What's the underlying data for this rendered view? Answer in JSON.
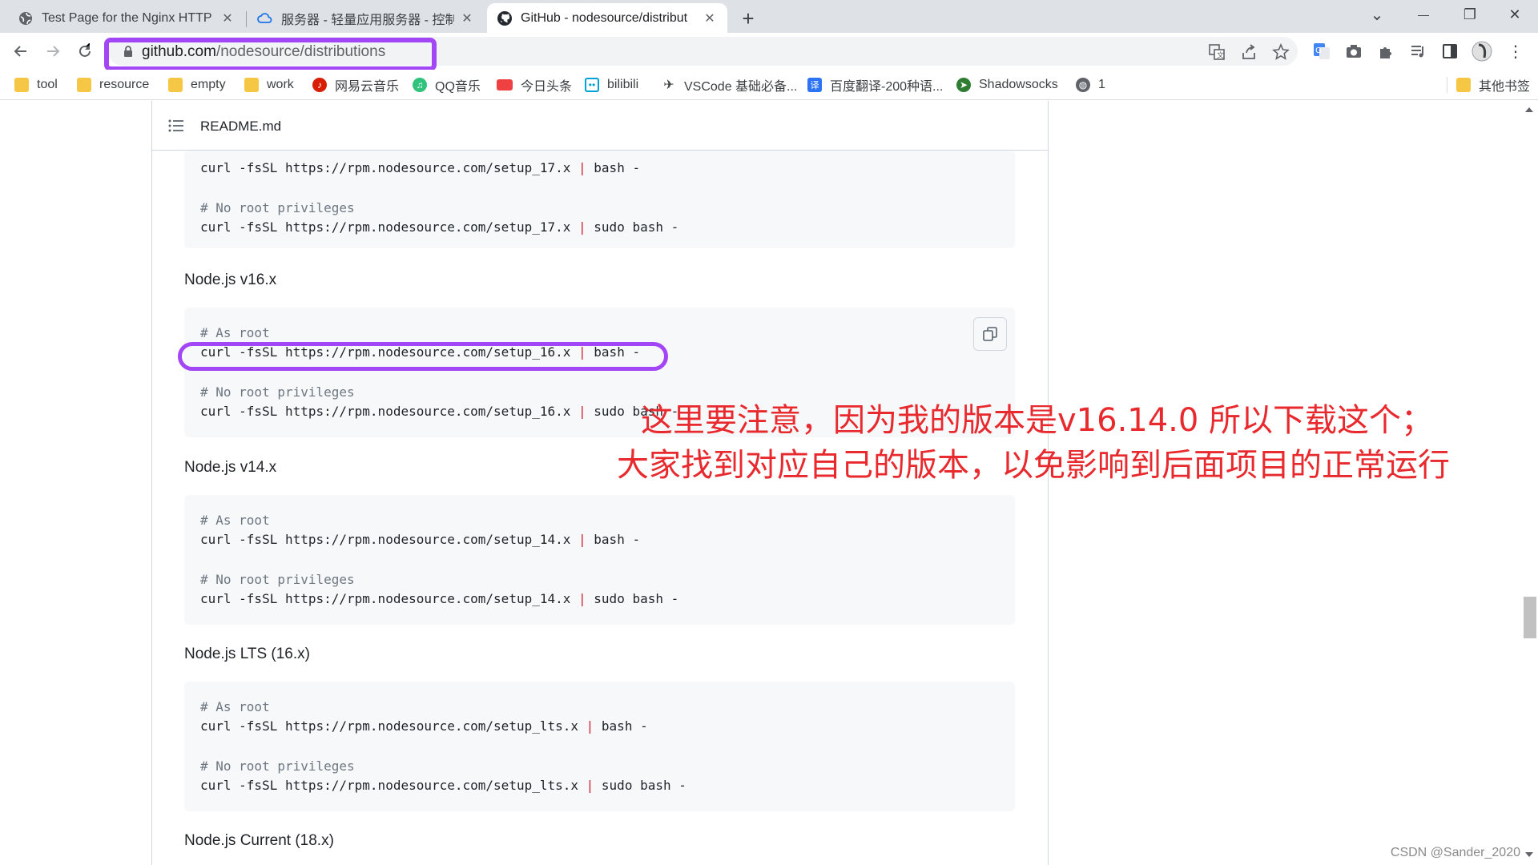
{
  "tabs": [
    {
      "title": "Test Page for the Nginx HTTP S",
      "icon": "globe-icon"
    },
    {
      "title": "服务器 - 轻量应用服务器 - 控制台",
      "icon": "cloud-icon"
    },
    {
      "title": "GitHub - nodesource/distribut",
      "icon": "github-icon"
    }
  ],
  "window_controls": {
    "new_tab": "+",
    "dropdown": "⌄",
    "minimize": "—",
    "restore": "❐",
    "close": "✕"
  },
  "address_bar": {
    "host": "github.com",
    "path": "/nodesource/distributions"
  },
  "bookmarks": [
    {
      "label": "tool",
      "icon": "folder-icon"
    },
    {
      "label": "resource",
      "icon": "folder-icon"
    },
    {
      "label": "empty",
      "icon": "folder-icon"
    },
    {
      "label": "work",
      "icon": "folder-icon"
    },
    {
      "label": "网易云音乐",
      "icon": "netease-music-icon"
    },
    {
      "label": "QQ音乐",
      "icon": "qq-music-icon"
    },
    {
      "label": "今日头条",
      "icon": "toutiao-icon"
    },
    {
      "label": "bilibili",
      "icon": "bilibili-icon"
    },
    {
      "label": "VSCode 基础必备...",
      "icon": "vscode-icon"
    },
    {
      "label": "百度翻译-200种语...",
      "icon": "baidu-translate-icon"
    },
    {
      "label": "Shadowsocks",
      "icon": "shadowsocks-icon"
    },
    {
      "label": "1",
      "icon": "globe-icon"
    },
    {
      "label": "其他书签",
      "icon": "folder-icon"
    }
  ],
  "readme": {
    "title": "README.md",
    "top_block": {
      "line1": {
        "cmd": "curl -fsSL https://rpm.nodesource.com/setup_17.x ",
        "pipe": "|",
        "rest": " bash -"
      },
      "comment2": "# No root privileges",
      "line2": {
        "cmd": "curl -fsSL https://rpm.nodesource.com/setup_17.x ",
        "pipe": "|",
        "rest": " sudo bash -"
      }
    },
    "sections": [
      {
        "heading": "Node.js v16.x",
        "comment1": "# As root",
        "line1": {
          "cmd": "curl -fsSL https://rpm.nodesource.com/setup_16.x ",
          "pipe": "|",
          "rest": " bash -"
        },
        "comment2": "# No root privileges",
        "line2": {
          "cmd": "curl -fsSL https://rpm.nodesource.com/setup_16.x ",
          "pipe": "|",
          "rest": " sudo bash -"
        }
      },
      {
        "heading": "Node.js v14.x",
        "comment1": "# As root",
        "line1": {
          "cmd": "curl -fsSL https://rpm.nodesource.com/setup_14.x ",
          "pipe": "|",
          "rest": " bash -"
        },
        "comment2": "# No root privileges",
        "line2": {
          "cmd": "curl -fsSL https://rpm.nodesource.com/setup_14.x ",
          "pipe": "|",
          "rest": " sudo bash -"
        }
      },
      {
        "heading": "Node.js LTS (16.x)",
        "comment1": "# As root",
        "line1": {
          "cmd": "curl -fsSL https://rpm.nodesource.com/setup_lts.x ",
          "pipe": "|",
          "rest": " bash -"
        },
        "comment2": "# No root privileges",
        "line2": {
          "cmd": "curl -fsSL https://rpm.nodesource.com/setup_lts.x ",
          "pipe": "|",
          "rest": " sudo bash -"
        }
      }
    ],
    "last_heading": "Node.js Current (18.x)"
  },
  "annotation": {
    "line1": "这里要注意，因为我的版本是v16.14.0  所以下载这个；",
    "line2": "大家找到对应自己的版本，以免影响到后面项目的正常运行"
  },
  "watermark": "CSDN @Sander_2020",
  "colors": {
    "highlight": "#a346f5",
    "annotation": "#e8292d",
    "pipe": "#cf222e"
  }
}
